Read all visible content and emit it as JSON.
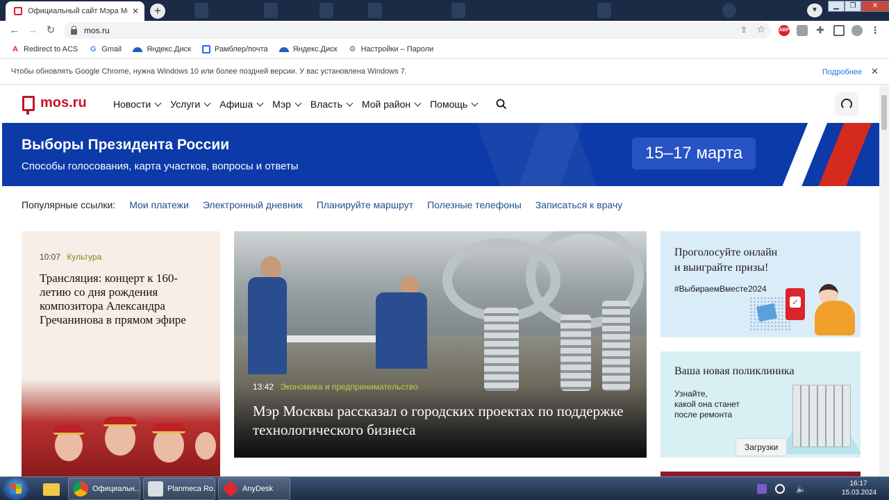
{
  "browser": {
    "tab_title": "Официальный сайт Мэра Москвы",
    "url": "mos.ru",
    "extension_abp": "ABP",
    "bookmarks": [
      {
        "label": "Redirect to ACS",
        "icon": "acrobat-icon"
      },
      {
        "label": "Gmail",
        "icon": "google-icon"
      },
      {
        "label": "Яндекс.Диск",
        "icon": "yandex-disk-icon"
      },
      {
        "label": "Рамблер/почта",
        "icon": "mail-icon"
      },
      {
        "label": "Яндекс.Диск",
        "icon": "yandex-disk-icon"
      },
      {
        "label": "Настройки – Пароли",
        "icon": "gear-icon"
      }
    ],
    "infobar": {
      "message": "Чтобы обновлять Google Chrome, нужна Windows 10 или более поздней версии. У вас установлена Windows 7.",
      "link": "Подробнее"
    },
    "downloads_tooltip": "Загрузки"
  },
  "site": {
    "logo": "mos.ru",
    "nav": [
      "Новости",
      "Услуги",
      "Афиша",
      "Мэр",
      "Власть",
      "Мой район",
      "Помощь"
    ],
    "banner": {
      "title": "Выборы Президента России",
      "subtitle": "Способы голосования, карта участков, вопросы и ответы",
      "dates": "15–17 марта"
    },
    "popular": {
      "label": "Популярные ссылки:",
      "links": [
        "Мои платежи",
        "Электронный дневник",
        "Планируйте маршрут",
        "Полезные телефоны",
        "Записаться к врачу"
      ]
    },
    "news_left": {
      "time": "10:07",
      "category": "Культура",
      "title": "Трансляция: концерт к 160-летию со дня рождения композитора Александра Гречанинова в прямом эфире"
    },
    "news_main": {
      "time": "13:42",
      "category": "Экономика и предпринимательство",
      "title": "Мэр Москвы рассказал о городских проектах по поддержке технологического бизнеса"
    },
    "promo_vote": {
      "title_line1": "Проголосуйте онлайн",
      "title_line2": "и выиграйте призы!",
      "hashtag": "#ВыбираемВместе2024"
    },
    "promo_clinic": {
      "title": "Ваша новая поликлиника",
      "subtitle_line1": "Узнайте,",
      "subtitle_line2": "какой она станет",
      "subtitle_line3": "после ремонта"
    }
  },
  "taskbar": {
    "apps": [
      {
        "label": "Официальн...",
        "icon": "chrome-icon"
      },
      {
        "label": "Planmeca Ro...",
        "icon": "planmeca-icon"
      },
      {
        "label": "AnyDesk",
        "icon": "anydesk-icon"
      }
    ],
    "time": "16:17",
    "date": "15.03.2024"
  },
  "colors": {
    "brand_red": "#c8102e",
    "banner_blue": "#0c3aa8",
    "link_blue": "#1f4f8a",
    "category_green": "#7a8a23"
  }
}
